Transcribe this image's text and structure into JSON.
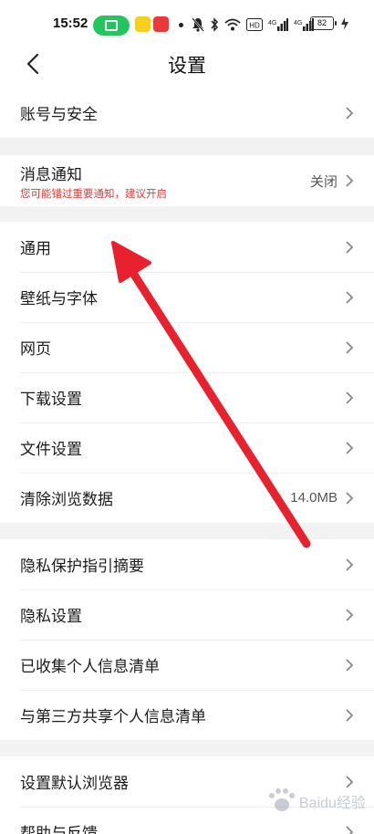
{
  "status_bar": {
    "time": "15:52",
    "battery": "82",
    "icons": [
      "display-icon",
      "meituan-app-icon",
      "pinduoduo-app-icon",
      "bell-muted-icon",
      "bluetooth-icon",
      "wifi-icon",
      "hd-icon",
      "signal-4g-icon",
      "signal-4g-icon",
      "battery-icon"
    ],
    "hd_text": "HD",
    "net1": "4G",
    "net2": "4G",
    "accent": "#22c55e"
  },
  "header": {
    "title": "设置",
    "back_icon": "chevron-left-icon"
  },
  "groups": [
    {
      "items": [
        {
          "label": "账号与安全",
          "value": ""
        }
      ]
    },
    {
      "items": [
        {
          "label": "消息通知",
          "sub": "您可能错过重要通知，建议开启",
          "value": "关闭"
        }
      ]
    },
    {
      "items": [
        {
          "label": "通用",
          "value": ""
        },
        {
          "label": "壁纸与字体",
          "value": ""
        },
        {
          "label": "网页",
          "value": ""
        },
        {
          "label": "下载设置",
          "value": ""
        },
        {
          "label": "文件设置",
          "value": ""
        },
        {
          "label": "清除浏览数据",
          "value": "14.0MB"
        }
      ]
    },
    {
      "items": [
        {
          "label": "隐私保护指引摘要",
          "value": ""
        },
        {
          "label": "隐私设置",
          "value": ""
        },
        {
          "label": "已收集个人信息清单",
          "value": ""
        },
        {
          "label": "与第三方共享个人信息清单",
          "value": ""
        }
      ]
    },
    {
      "items": [
        {
          "label": "设置默认浏览器",
          "value": ""
        },
        {
          "label": "帮助与反馈",
          "value": ""
        }
      ]
    }
  ],
  "colors": {
    "warning_text": "#e53935",
    "arrow": "#e8212e",
    "divider_band": "#f2f2f2"
  },
  "watermark": {
    "text": "Baidu经验"
  }
}
